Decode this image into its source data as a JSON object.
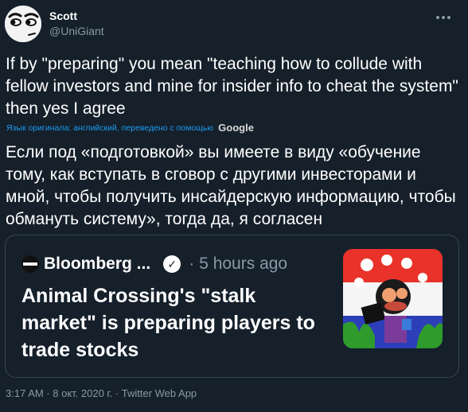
{
  "user": {
    "display_name": "Scott",
    "handle": "@UniGiant"
  },
  "menu_icon": "more-dots-icon",
  "tweet": {
    "text_en": "If by \"preparing\" you mean \"teaching how to collude with fellow investors and mine for insider info to cheat the system\" then yes I agree",
    "translation_note": "Язык оригинала: английский, переведено с помощью",
    "translation_provider": "Google",
    "text_ru": "Если под «подготовкой» вы имеете в виду «обучение тому, как вступать в сговор с другими инвесторами и мной, чтобы получить инсайдерскую информацию, чтобы обмануть систему», тогда да, я согласен"
  },
  "quote_card": {
    "source_name": "Bloomberg ...",
    "verified_icon": "verified-badge-icon",
    "separator": "·",
    "time": "5 hours ago",
    "headline": "Animal Crossing's \"stalk market\" is preparing players to trade stocks",
    "thumbnail_icon": "animal-crossing-thumbnail"
  },
  "footer": {
    "meta": "3:17 AM · 8 окт. 2020 г. · Twitter Web App"
  },
  "colors": {
    "background": "#15202b",
    "border": "#38444d",
    "muted": "#8899a6",
    "link": "#1d9bf0"
  }
}
